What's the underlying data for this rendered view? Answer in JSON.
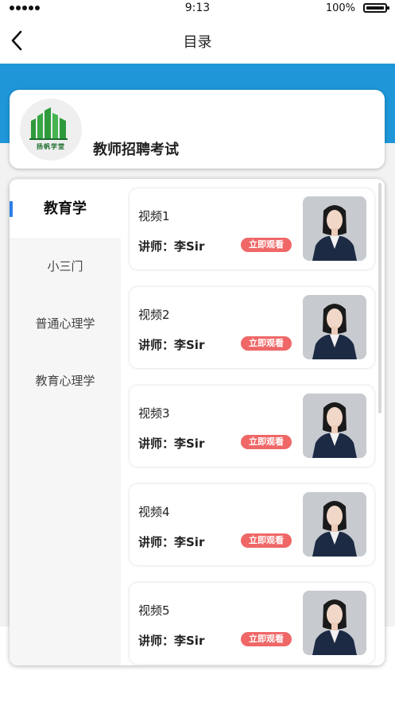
{
  "status_bar": {
    "time": "9:13",
    "battery": "100%"
  },
  "nav": {
    "title": "目录"
  },
  "course": {
    "title": "教师招聘考试",
    "logo_text": "扬帆学堂"
  },
  "sidebar": {
    "items": [
      {
        "label": "教育学",
        "active": true
      },
      {
        "label": "小三门"
      },
      {
        "label": "普通心理学"
      },
      {
        "label": "教育心理学"
      }
    ]
  },
  "videos": [
    {
      "title": "视频1",
      "teacher": "讲师：李Sir",
      "button": "立即观看"
    },
    {
      "title": "视频2",
      "teacher": "讲师：李Sir",
      "button": "立即观看"
    },
    {
      "title": "视频3",
      "teacher": "讲师：李Sir",
      "button": "立即观看"
    },
    {
      "title": "视频4",
      "teacher": "讲师：李Sir",
      "button": "立即观看"
    },
    {
      "title": "视频5",
      "teacher": "讲师：李Sir",
      "button": "立即观看"
    }
  ],
  "colors": {
    "brand_blue": "#1e96d8",
    "accent_red": "#ef6767",
    "indicator_blue": "#2f7fe8"
  },
  "icons": {
    "back": "chevron-left-icon",
    "logo": "building-logo-icon"
  }
}
